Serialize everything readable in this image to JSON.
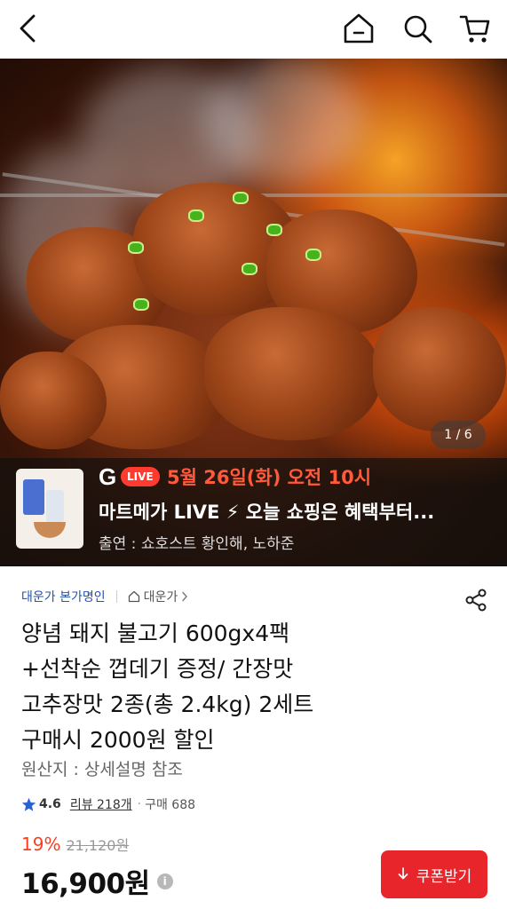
{
  "topbar": {
    "back_icon": "chevron-left-icon",
    "home_icon": "home-icon",
    "search_icon": "search-icon",
    "cart_icon": "cart-icon"
  },
  "hero": {
    "counter": "1 / 6"
  },
  "live": {
    "g_logo": "G",
    "pill": "LIVE",
    "date": "5월 26일(화) 오전 10시",
    "title": "마트메가 LIVE ⚡ 오늘 쇼핑은 혜택부터...",
    "host": "출연 : 쇼호스트 황인해, 노하준"
  },
  "product": {
    "seller": "대운가 본가명인",
    "brand": "대운가",
    "title_lines": [
      "양념 돼지 불고기 600gx4팩",
      "+선착순 껍데기 증정/ 간장맛",
      "고추장맛 2종(총 2.4kg) 2세트",
      "구매시 2000원 할인"
    ],
    "origin": "원산지 : 상세설명 참조",
    "rating": "4.6",
    "reviews": "리뷰 218개",
    "purchases": "구매 688",
    "discount": "19%",
    "original_price": "21,120원",
    "price": "16,900원",
    "coupon_label": "쿠폰받기"
  },
  "colors": {
    "accent_red": "#e8252b",
    "discount_red": "#ff3b20",
    "seller_blue": "#2753a8",
    "live_orange": "#ff5a3c"
  }
}
